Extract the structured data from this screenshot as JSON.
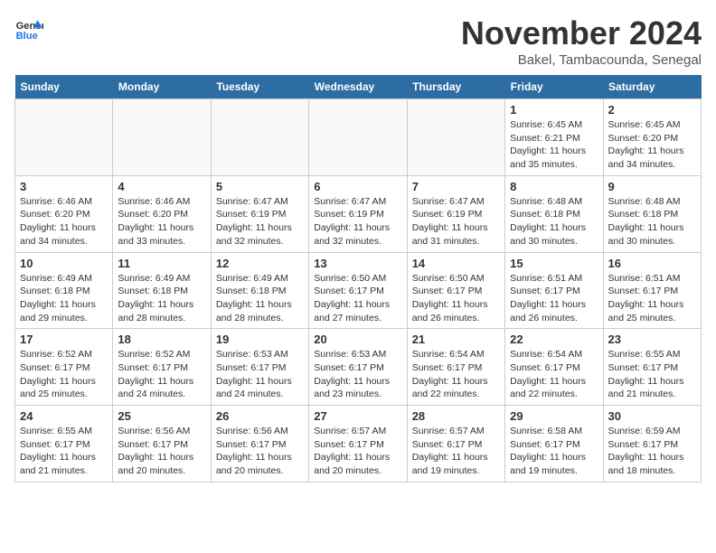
{
  "header": {
    "logo_line1": "General",
    "logo_line2": "Blue",
    "month": "November 2024",
    "location": "Bakel, Tambacounda, Senegal"
  },
  "weekdays": [
    "Sunday",
    "Monday",
    "Tuesday",
    "Wednesday",
    "Thursday",
    "Friday",
    "Saturday"
  ],
  "weeks": [
    [
      {
        "day": "",
        "info": ""
      },
      {
        "day": "",
        "info": ""
      },
      {
        "day": "",
        "info": ""
      },
      {
        "day": "",
        "info": ""
      },
      {
        "day": "",
        "info": ""
      },
      {
        "day": "1",
        "info": "Sunrise: 6:45 AM\nSunset: 6:21 PM\nDaylight: 11 hours and 35 minutes."
      },
      {
        "day": "2",
        "info": "Sunrise: 6:45 AM\nSunset: 6:20 PM\nDaylight: 11 hours and 34 minutes."
      }
    ],
    [
      {
        "day": "3",
        "info": "Sunrise: 6:46 AM\nSunset: 6:20 PM\nDaylight: 11 hours and 34 minutes."
      },
      {
        "day": "4",
        "info": "Sunrise: 6:46 AM\nSunset: 6:20 PM\nDaylight: 11 hours and 33 minutes."
      },
      {
        "day": "5",
        "info": "Sunrise: 6:47 AM\nSunset: 6:19 PM\nDaylight: 11 hours and 32 minutes."
      },
      {
        "day": "6",
        "info": "Sunrise: 6:47 AM\nSunset: 6:19 PM\nDaylight: 11 hours and 32 minutes."
      },
      {
        "day": "7",
        "info": "Sunrise: 6:47 AM\nSunset: 6:19 PM\nDaylight: 11 hours and 31 minutes."
      },
      {
        "day": "8",
        "info": "Sunrise: 6:48 AM\nSunset: 6:18 PM\nDaylight: 11 hours and 30 minutes."
      },
      {
        "day": "9",
        "info": "Sunrise: 6:48 AM\nSunset: 6:18 PM\nDaylight: 11 hours and 30 minutes."
      }
    ],
    [
      {
        "day": "10",
        "info": "Sunrise: 6:49 AM\nSunset: 6:18 PM\nDaylight: 11 hours and 29 minutes."
      },
      {
        "day": "11",
        "info": "Sunrise: 6:49 AM\nSunset: 6:18 PM\nDaylight: 11 hours and 28 minutes."
      },
      {
        "day": "12",
        "info": "Sunrise: 6:49 AM\nSunset: 6:18 PM\nDaylight: 11 hours and 28 minutes."
      },
      {
        "day": "13",
        "info": "Sunrise: 6:50 AM\nSunset: 6:17 PM\nDaylight: 11 hours and 27 minutes."
      },
      {
        "day": "14",
        "info": "Sunrise: 6:50 AM\nSunset: 6:17 PM\nDaylight: 11 hours and 26 minutes."
      },
      {
        "day": "15",
        "info": "Sunrise: 6:51 AM\nSunset: 6:17 PM\nDaylight: 11 hours and 26 minutes."
      },
      {
        "day": "16",
        "info": "Sunrise: 6:51 AM\nSunset: 6:17 PM\nDaylight: 11 hours and 25 minutes."
      }
    ],
    [
      {
        "day": "17",
        "info": "Sunrise: 6:52 AM\nSunset: 6:17 PM\nDaylight: 11 hours and 25 minutes."
      },
      {
        "day": "18",
        "info": "Sunrise: 6:52 AM\nSunset: 6:17 PM\nDaylight: 11 hours and 24 minutes."
      },
      {
        "day": "19",
        "info": "Sunrise: 6:53 AM\nSunset: 6:17 PM\nDaylight: 11 hours and 24 minutes."
      },
      {
        "day": "20",
        "info": "Sunrise: 6:53 AM\nSunset: 6:17 PM\nDaylight: 11 hours and 23 minutes."
      },
      {
        "day": "21",
        "info": "Sunrise: 6:54 AM\nSunset: 6:17 PM\nDaylight: 11 hours and 22 minutes."
      },
      {
        "day": "22",
        "info": "Sunrise: 6:54 AM\nSunset: 6:17 PM\nDaylight: 11 hours and 22 minutes."
      },
      {
        "day": "23",
        "info": "Sunrise: 6:55 AM\nSunset: 6:17 PM\nDaylight: 11 hours and 21 minutes."
      }
    ],
    [
      {
        "day": "24",
        "info": "Sunrise: 6:55 AM\nSunset: 6:17 PM\nDaylight: 11 hours and 21 minutes."
      },
      {
        "day": "25",
        "info": "Sunrise: 6:56 AM\nSunset: 6:17 PM\nDaylight: 11 hours and 20 minutes."
      },
      {
        "day": "26",
        "info": "Sunrise: 6:56 AM\nSunset: 6:17 PM\nDaylight: 11 hours and 20 minutes."
      },
      {
        "day": "27",
        "info": "Sunrise: 6:57 AM\nSunset: 6:17 PM\nDaylight: 11 hours and 20 minutes."
      },
      {
        "day": "28",
        "info": "Sunrise: 6:57 AM\nSunset: 6:17 PM\nDaylight: 11 hours and 19 minutes."
      },
      {
        "day": "29",
        "info": "Sunrise: 6:58 AM\nSunset: 6:17 PM\nDaylight: 11 hours and 19 minutes."
      },
      {
        "day": "30",
        "info": "Sunrise: 6:59 AM\nSunset: 6:17 PM\nDaylight: 11 hours and 18 minutes."
      }
    ]
  ]
}
